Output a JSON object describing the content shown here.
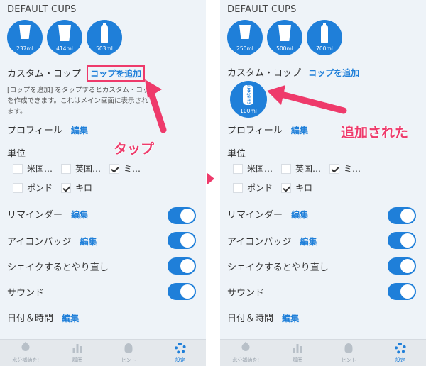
{
  "left": {
    "section_title": "DEFAULT CUPS",
    "cups": [
      {
        "ml": "237ml",
        "icon": "cup-icon"
      },
      {
        "ml": "414ml",
        "icon": "cup-icon"
      },
      {
        "ml": "503ml",
        "icon": "bottle-icon"
      }
    ],
    "custom_label": "カスタム・コップ",
    "add_cup": "コップを追加",
    "desc_line1": "[コップを追加] をタップするとカスタム・コップ",
    "desc_line2": "を作成できます。これはメイン画面に表示され",
    "desc_line3": "ます。",
    "callout": "タップ"
  },
  "right": {
    "section_title": "DEFAULT CUPS",
    "cups": [
      {
        "ml": "250ml",
        "icon": "cup-icon"
      },
      {
        "ml": "500ml",
        "icon": "cup-icon"
      },
      {
        "ml": "700ml",
        "icon": "bottle-icon"
      }
    ],
    "custom_label": "カスタム・コップ",
    "add_cup": "コップを追加",
    "custom_cup_text": "custom",
    "custom_cup_ml": "100ml",
    "callout": "追加された"
  },
  "profile": {
    "label": "プロフィール",
    "edit": "編集"
  },
  "units": {
    "title": "単位",
    "options": [
      {
        "label": "米国…",
        "checked": false
      },
      {
        "label": "英国…",
        "checked": false
      },
      {
        "label": "ミ…",
        "checked": true
      },
      {
        "label": "ポンド",
        "checked": false
      },
      {
        "label": "キロ",
        "checked": true
      }
    ]
  },
  "reminder": {
    "label": "リマインダー",
    "edit": "編集",
    "on": true
  },
  "icon_badge": {
    "label": "アイコンバッジ",
    "edit": "編集",
    "on": true
  },
  "shake": {
    "label": "シェイクするとやり直し",
    "on": true
  },
  "sound": {
    "label": "サウンド",
    "on": true
  },
  "datetime": {
    "label": "日付＆時間",
    "edit": "編集"
  },
  "tabs": [
    {
      "label": "水分補給を!",
      "icon": "drop-icon"
    },
    {
      "label": "履歴",
      "icon": "chart-icon"
    },
    {
      "label": "ヒント",
      "icon": "bulb-icon"
    },
    {
      "label": "設定",
      "icon": "gear-icon"
    }
  ],
  "colors": {
    "accent": "#1f7fd9",
    "highlight": "#ee3a6b",
    "background": "#eef3f8"
  }
}
